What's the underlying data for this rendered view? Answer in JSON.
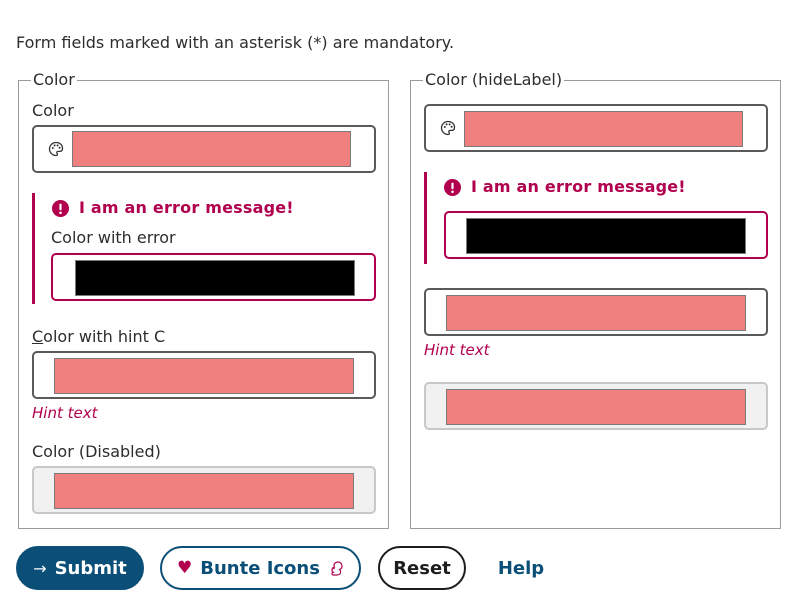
{
  "intro": "Form fields marked with an asterisk (*) are mandatory.",
  "colors": {
    "swatch_default": "#f08080",
    "swatch_error": "#000000",
    "error": "#b0004e",
    "primary": "#0b4f78"
  },
  "left_group": {
    "legend": "Color",
    "field1": {
      "label": "Color",
      "icon": "palette-icon"
    },
    "field2": {
      "error_message": "I am an error message!",
      "label": "Color with error"
    },
    "field3": {
      "label_prefix": "C",
      "label_rest": "olor with hint C",
      "hint": "Hint text"
    },
    "field4": {
      "label": "Color (Disabled)"
    }
  },
  "right_group": {
    "legend": "Color (hideLabel)",
    "field2": {
      "error_message": "I am an error message!"
    },
    "field3": {
      "hint": "Hint text"
    }
  },
  "buttons": {
    "submit": "Submit",
    "bunte": "Bunte Icons",
    "reset": "Reset",
    "help": "Help"
  }
}
